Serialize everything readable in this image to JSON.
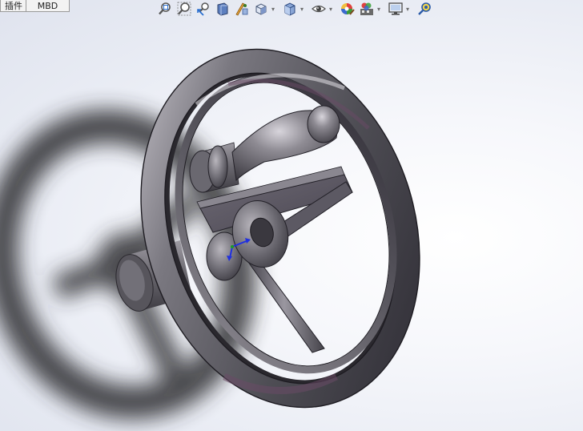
{
  "tabs": [
    {
      "label": "插件"
    },
    {
      "label": "MBD"
    }
  ],
  "heads_up_toolbar": {
    "tools": [
      {
        "icon": "zoom-to-fit-icon"
      },
      {
        "icon": "zoom-to-area-icon"
      },
      {
        "icon": "previous-view-icon"
      },
      {
        "icon": "section-view-icon"
      },
      {
        "icon": "dynamic-annotation-views-icon"
      },
      {
        "icon": "view-orientation-icon",
        "has_menu": true
      },
      {
        "icon": "display-style-icon",
        "has_menu": true
      },
      {
        "icon": "hide-show-items-icon",
        "has_menu": true
      },
      {
        "icon": "edit-appearance-icon"
      },
      {
        "icon": "apply-scene-icon",
        "has_menu": true
      },
      {
        "icon": "view-settings-icon",
        "has_menu": true
      },
      {
        "icon": "display-pane-icon"
      }
    ]
  },
  "model": {
    "object": "handwheel-with-handle",
    "rim_color": "#5b5a60",
    "highlight_color": "#b9b5be",
    "edge_color": "#1e1c22",
    "tint_color": "#6a4a66",
    "shadow_color": "#3a3a3c",
    "triad_colors": {
      "x": "#e23030",
      "y": "#1a9a2a",
      "z": "#2030e0"
    }
  }
}
